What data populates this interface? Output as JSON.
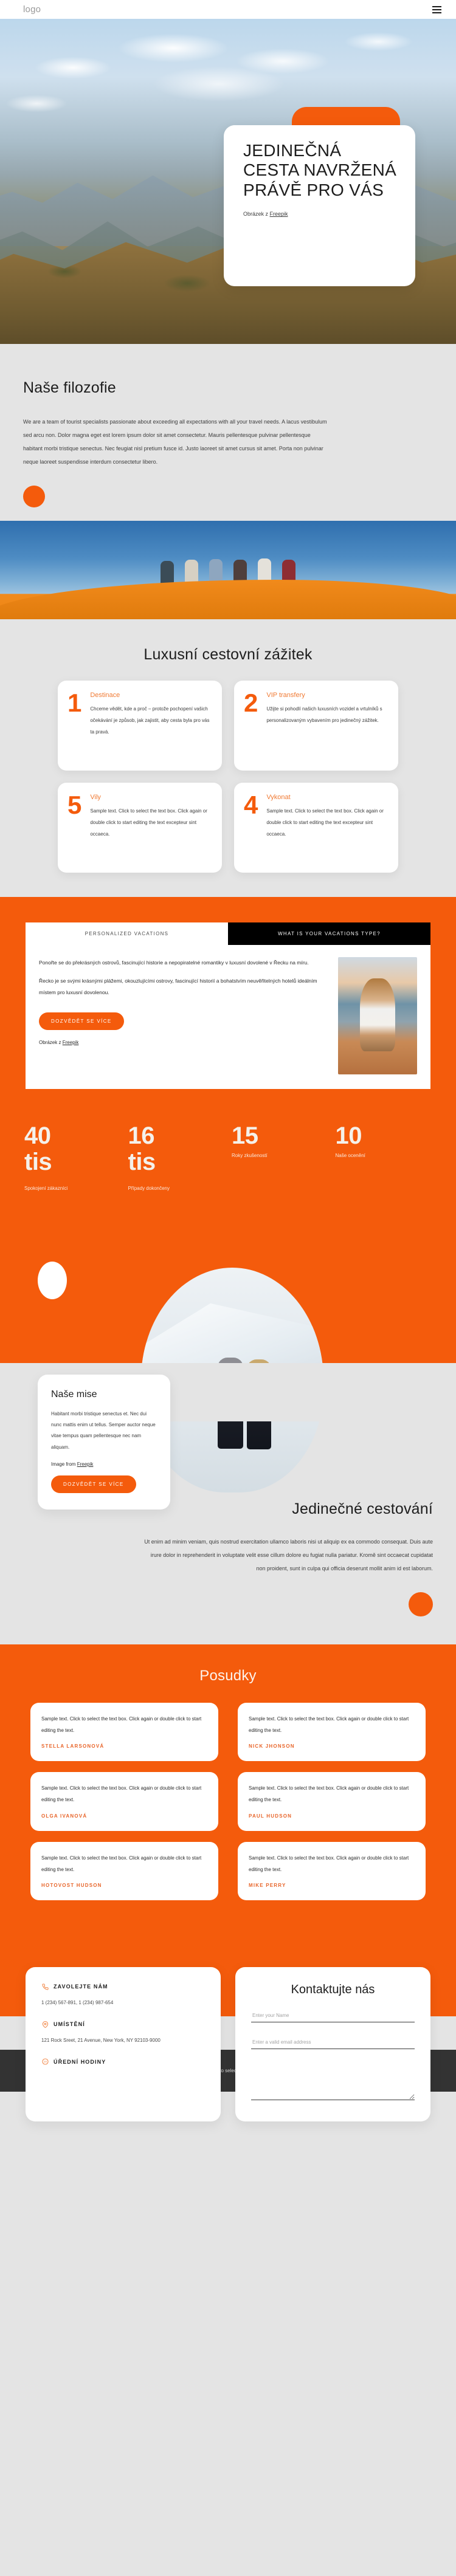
{
  "header": {
    "logo": "logo",
    "menu_icon": "hamburger-menu-icon"
  },
  "hero": {
    "title": "JEDINEČNÁ CESTA NAVRŽENÁ PRÁVĚ PRO VÁS",
    "credit_prefix": "Obrázek z ",
    "credit_link": "Freepik"
  },
  "philosophy": {
    "title": "Naše filozofie",
    "text": "We are a team of tourist specialists passionate about exceeding all expectations with all your travel needs. A lacus vestibulum sed arcu non. Dolor magna eget est lorem ipsum dolor sit amet consectetur. Mauris pellentesque pulvinar pellentesque habitant morbi tristique senectus. Nec feugiat nisl pretium fusce id. Justo laoreet sit amet cursus sit amet. Porta non pulvinar neque laoreet suspendisse interdum consectetur libero."
  },
  "luxury": {
    "title": "Luxusní cestovní zážitek",
    "cards": [
      {
        "num": "1",
        "title": "Destinace",
        "text": "Chceme vědět, kde a proč – protože pochopení vašich očekávání je způsob, jak zajistit, aby cesta byla pro vás ta pravá."
      },
      {
        "num": "2",
        "title": "VIP transfery",
        "text": "Užijte si pohodlí našich luxusních vozidel a vrtulníků s personalizovaným vybavením pro jedinečný zážitek."
      },
      {
        "num": "5",
        "title": "Vily",
        "text": "Sample text. Click to select the text box. Click again or double click to start editing the text excepteur sint occaeca."
      },
      {
        "num": "4",
        "title": "Vykonat",
        "text": "Sample text. Click to select the text box. Click again or double click to start editing the text excepteur sint occaeca."
      }
    ]
  },
  "tabs": {
    "items": [
      {
        "label": "PERSONALIZED VACATIONS",
        "active": false
      },
      {
        "label": "WHAT IS YOUR VACATIONS TYPE?",
        "active": true
      }
    ],
    "paragraph1": "Ponořte se do překrásných ostrovů, fascinující historie a nepopiratelné romantiky v luxusní dovolené v Řecku na míru.",
    "paragraph2": "Řecko je se svými krásnými plážemi, okouzlujícími ostrovy, fascinující historií a bohatstvím neuvěřitelných hotelů ideálním místem pro luxusní dovolenou.",
    "button": "DOZVĚDĚT SE VÍCE",
    "credit_prefix": "Obrázek z ",
    "credit_link": "Freepik"
  },
  "stats": [
    {
      "value": "40 tis",
      "label": "Spokojení zákazníci"
    },
    {
      "value": "16 tis",
      "label": "Případy dokončeny"
    },
    {
      "value": "15",
      "label": "Roky zkušeností"
    },
    {
      "value": "10",
      "label": "Naše ocenění"
    }
  ],
  "mission": {
    "title": "Naše mise",
    "text": "Habitant morbi tristique senectus et. Nec dui nunc mattis enim ut tellus. Semper auctor neque vitae tempus quam pellentesque nec nam aliquam.",
    "credit_prefix": "Image from ",
    "credit_link": "Freepik",
    "button": "DOZVĚDĚT SE VÍCE"
  },
  "unique": {
    "title": "Jedinečné cestování",
    "text": "Ut enim ad minim veniam, quis nostrud exercitation ullamco laboris nisi ut aliquip ex ea commodo consequat. Duis aute irure dolor in reprehenderit in voluptate velit esse cillum dolore eu fugiat nulla pariatur. Kromě sint occaecat cupidatat non proident, sunt in culpa qui officia deserunt mollit anim id est laborum."
  },
  "testimonials": {
    "title": "Posudky",
    "items": [
      {
        "text": "Sample text. Click to select the text box. Click again or double click to start editing the text.",
        "author": "STELLA LARSONOVÁ"
      },
      {
        "text": "Sample text. Click to select the text box. Click again or double click to start editing the text.",
        "author": "NICK JHONSON"
      },
      {
        "text": "Sample text. Click to select the text box. Click again or double click to start editing the text.",
        "author": "OLGA IVANOVÁ"
      },
      {
        "text": "Sample text. Click to select the text box. Click again or double click to start editing the text.",
        "author": "PAUL HUDSON"
      },
      {
        "text": "Sample text. Click to select the text box. Click again or double click to start editing the text.",
        "author": "HOTOVOST HUDSON"
      },
      {
        "text": "Sample text. Click to select the text box. Click again or double click to start editing the text.",
        "author": "MIKE PERRY"
      }
    ]
  },
  "contact": {
    "phone_label": "ZAVOLEJTE NÁM",
    "phone_icon": "phone-icon",
    "phone_value": "1 (234) 567-891, 1 (234) 987-654",
    "location_label": "UMÍSTĚNÍ",
    "location_icon": "map-pin-icon",
    "location_value": "121 Rock Sreet, 21 Avenue, New York, NY 92103-9000",
    "hours_label": "ÚŘEDNÍ HODINY",
    "hours_icon": "clock-24-icon",
    "form_title": "Kontaktujte nás",
    "name_placeholder": "Enter your Name",
    "email_placeholder": "Enter a valid email address",
    "message_placeholder": ""
  },
  "footer": {
    "text": "Sample text. Click to select the Text Element."
  },
  "colors": {
    "accent": "#f45b0c",
    "accent_light": "#f07a33",
    "page_bg": "#e4e4e4",
    "footer_bg": "#333333"
  }
}
